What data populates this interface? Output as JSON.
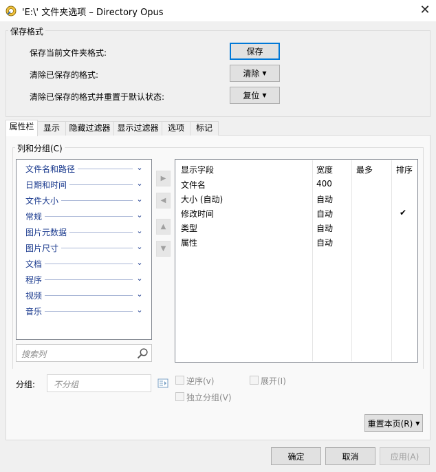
{
  "window": {
    "title": "'E:\\' 文件夹选项 – Directory Opus",
    "close_glyph": "✕"
  },
  "save_format": {
    "legend": "保存格式",
    "rows": [
      {
        "label": "保存当前文件夹格式:",
        "button": "保存"
      },
      {
        "label": "清除已保存的格式:",
        "button": "清除"
      },
      {
        "label": "清除已保存的格式并重置于默认状态:",
        "button": "复位"
      }
    ]
  },
  "tabs": [
    "属性栏",
    "显示",
    "隐藏过滤器",
    "显示过滤器",
    "选项",
    "标记"
  ],
  "columns_group": {
    "legend": "列和分组(C)",
    "categories": [
      "文件名和路径",
      "日期和时间",
      "文件大小",
      "常规",
      "图片元数据",
      "图片尺寸",
      "文档",
      "程序",
      "视频",
      "音乐"
    ],
    "search_placeholder": "搜索列",
    "table": {
      "headers": [
        "显示字段",
        "宽度",
        "最多",
        "排序"
      ],
      "rows": [
        {
          "field": "文件名",
          "width": "400",
          "max": "",
          "sort": ""
        },
        {
          "field": "大小 (自动)",
          "width": "自动",
          "max": "",
          "sort": ""
        },
        {
          "field": "修改时间",
          "width": "自动",
          "max": "",
          "sort": "✔"
        },
        {
          "field": "类型",
          "width": "自动",
          "max": "",
          "sort": ""
        },
        {
          "field": "属性",
          "width": "自动",
          "max": "",
          "sort": ""
        }
      ]
    }
  },
  "grouping": {
    "label": "分组:",
    "placeholder": "不分组",
    "reverse_label": "逆序(v)",
    "expand_label": "展开(I)",
    "independent_label": "独立分组(V)"
  },
  "reset_page_label": "重置本页(R)",
  "footer": {
    "ok": "确定",
    "cancel": "取消",
    "apply": "应用(A)"
  }
}
